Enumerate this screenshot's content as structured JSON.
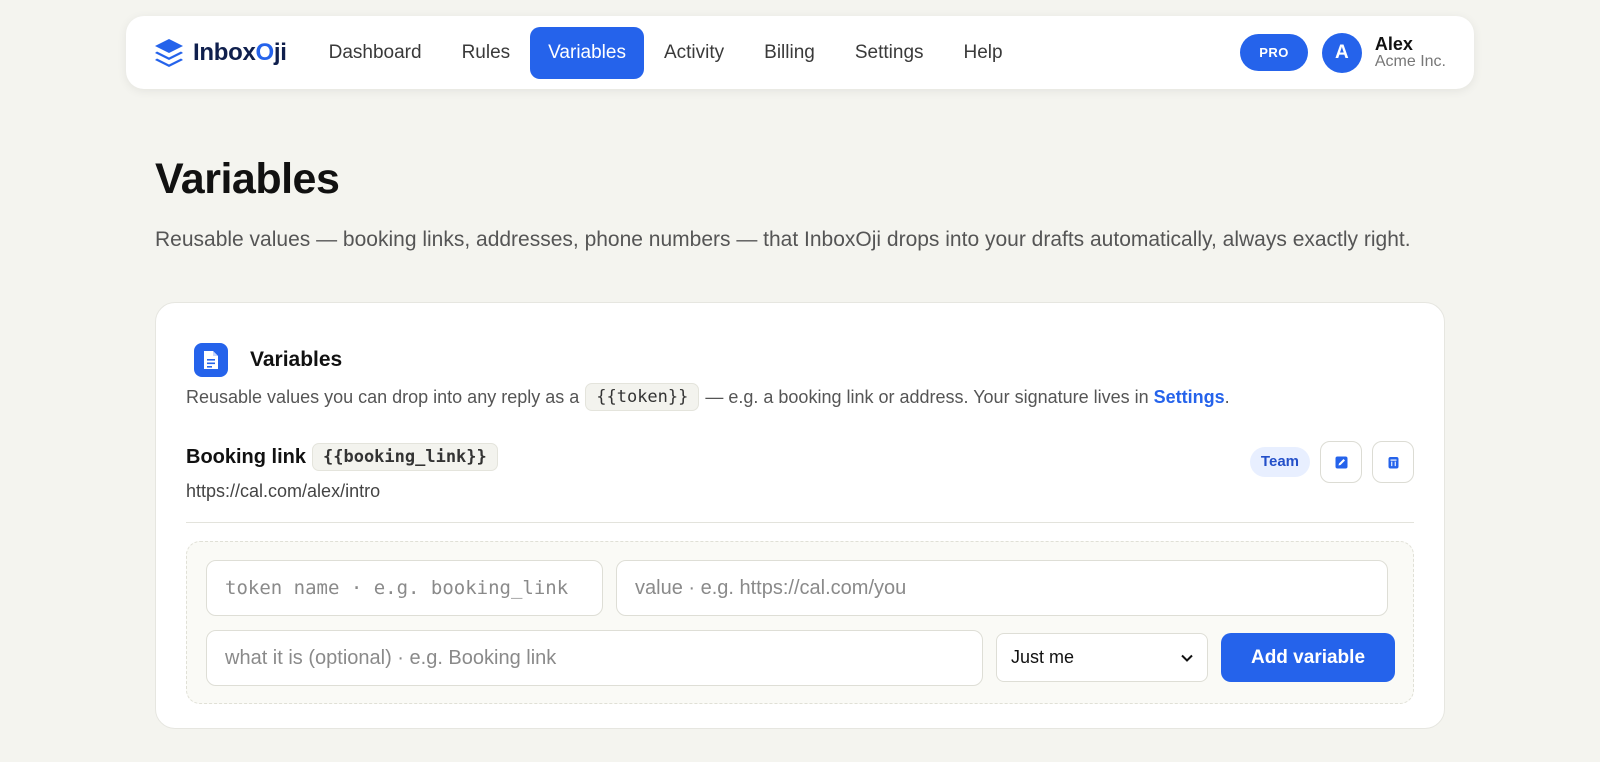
{
  "app": {
    "logo_text_a": "Inbox",
    "logo_text_b": "O",
    "logo_text_c": "ji",
    "accent_color": "#2563eb"
  },
  "nav": {
    "items": [
      {
        "label": "Dashboard"
      },
      {
        "label": "Rules"
      },
      {
        "label": "Variables",
        "active": true
      },
      {
        "label": "Activity"
      },
      {
        "label": "Billing"
      },
      {
        "label": "Settings"
      },
      {
        "label": "Help"
      }
    ]
  },
  "user": {
    "plan_badge": "PRO",
    "avatar_initial": "A",
    "name": "Alex",
    "org": "Acme Inc."
  },
  "page": {
    "title": "Variables",
    "description": "Reusable values — booking links, addresses, phone numbers — that InboxOji drops into your drafts automatically, always exactly right."
  },
  "card": {
    "icon": "document-icon",
    "title": "Variables",
    "desc_before": "Reusable values you can drop into any reply as a",
    "desc_token": "{{token}}",
    "desc_after": "— e.g. a booking link or address. Your signature lives in",
    "desc_link": "Settings",
    "desc_end": "."
  },
  "variables": [
    {
      "label": "Booking link",
      "token": "{{booking_link}}",
      "value": "https://cal.com/alex/intro",
      "scope_badge": "Team",
      "edit_icon": "edit-icon",
      "delete_icon": "trash-icon"
    }
  ],
  "form": {
    "token_placeholder": "token name · e.g. booking_link",
    "value_placeholder": "value · e.g. https://cal.com/you",
    "desc_placeholder": "what it is (optional) · e.g. Booking link",
    "scope_selected": "Just me",
    "add_label": "Add variable"
  }
}
